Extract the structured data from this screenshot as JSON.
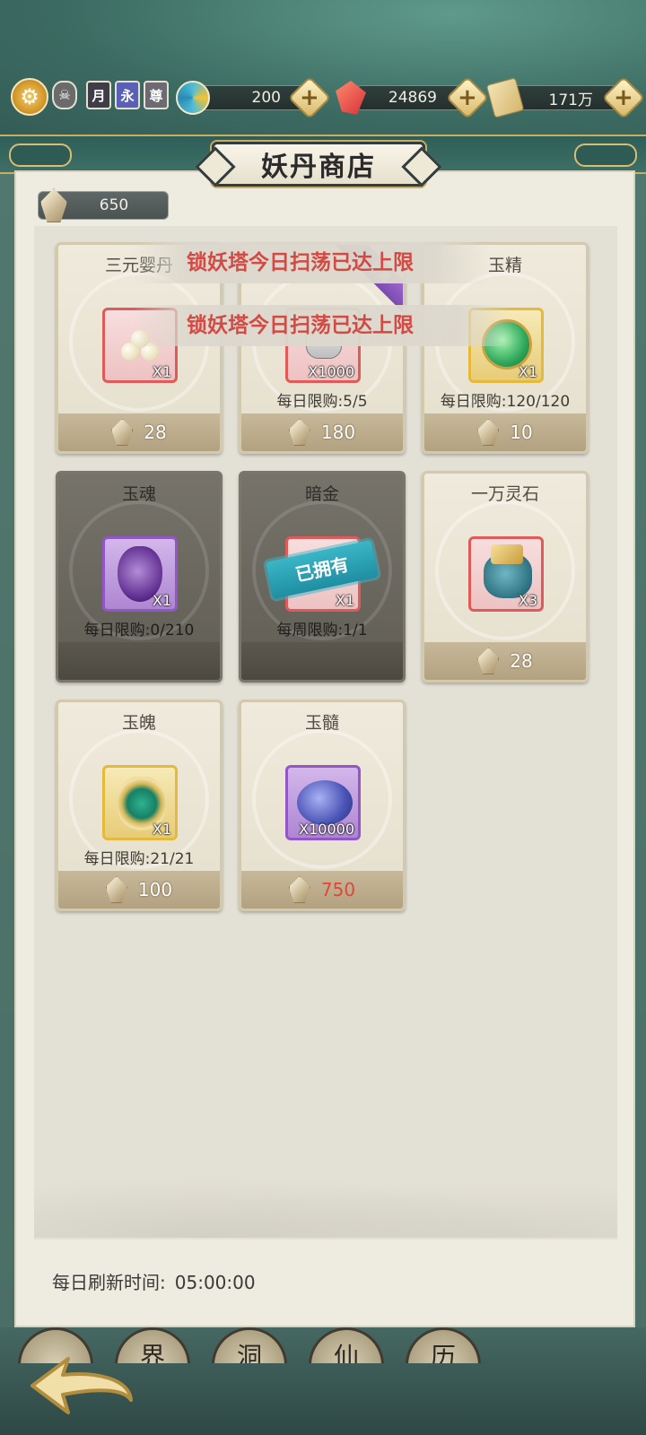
{
  "topbar": {
    "settings_icon": "gear-icon",
    "badges": [
      "☠",
      "月",
      "永",
      "尊"
    ],
    "resources": [
      {
        "icon": "swirl-icon",
        "value": "200"
      },
      {
        "icon": "red-crystal-icon",
        "value": "24869"
      },
      {
        "icon": "scroll-icon",
        "value": "171万"
      }
    ]
  },
  "shop": {
    "title": "妖丹商店",
    "balance": "650",
    "refresh_label": "每日刷新时间:",
    "refresh_time": "05:00:00"
  },
  "toasts": [
    "锁妖塔今日扫荡已达上限",
    "锁妖塔今日扫荡已达上限"
  ],
  "items": [
    {
      "name": "三元婴丹",
      "qty": "X1",
      "limit": "",
      "price": "28",
      "state": "normal"
    },
    {
      "name": "",
      "qty": "X1000",
      "limit": "每日限购:5/5",
      "price": "180",
      "state": "normal"
    },
    {
      "name": "玉精",
      "qty": "X1",
      "limit": "每日限购:120/120",
      "price": "10",
      "state": "normal"
    },
    {
      "name": "玉魂",
      "qty": "X1",
      "limit": "每日限购:0/210",
      "price": "",
      "state": "soldout"
    },
    {
      "name": "暗金",
      "qty": "X1",
      "limit": "每周限购:1/1",
      "price": "",
      "state": "owned",
      "owned_label": "已拥有"
    },
    {
      "name": "一万灵石",
      "qty": "X3",
      "limit": "",
      "price": "28",
      "state": "normal"
    },
    {
      "name": "玉魄",
      "qty": "X1",
      "limit": "每日限购:21/21",
      "price": "100",
      "state": "normal"
    },
    {
      "name": "玉髓",
      "qty": "X10000",
      "limit": "",
      "price": "750",
      "state": "normal"
    }
  ],
  "bottom_nav": [
    "",
    "界",
    "洞",
    "仙",
    "历"
  ],
  "colors": {
    "accent_gold": "#c9ad63",
    "price_red": "#e0463a",
    "toast_red": "#d24a44"
  }
}
